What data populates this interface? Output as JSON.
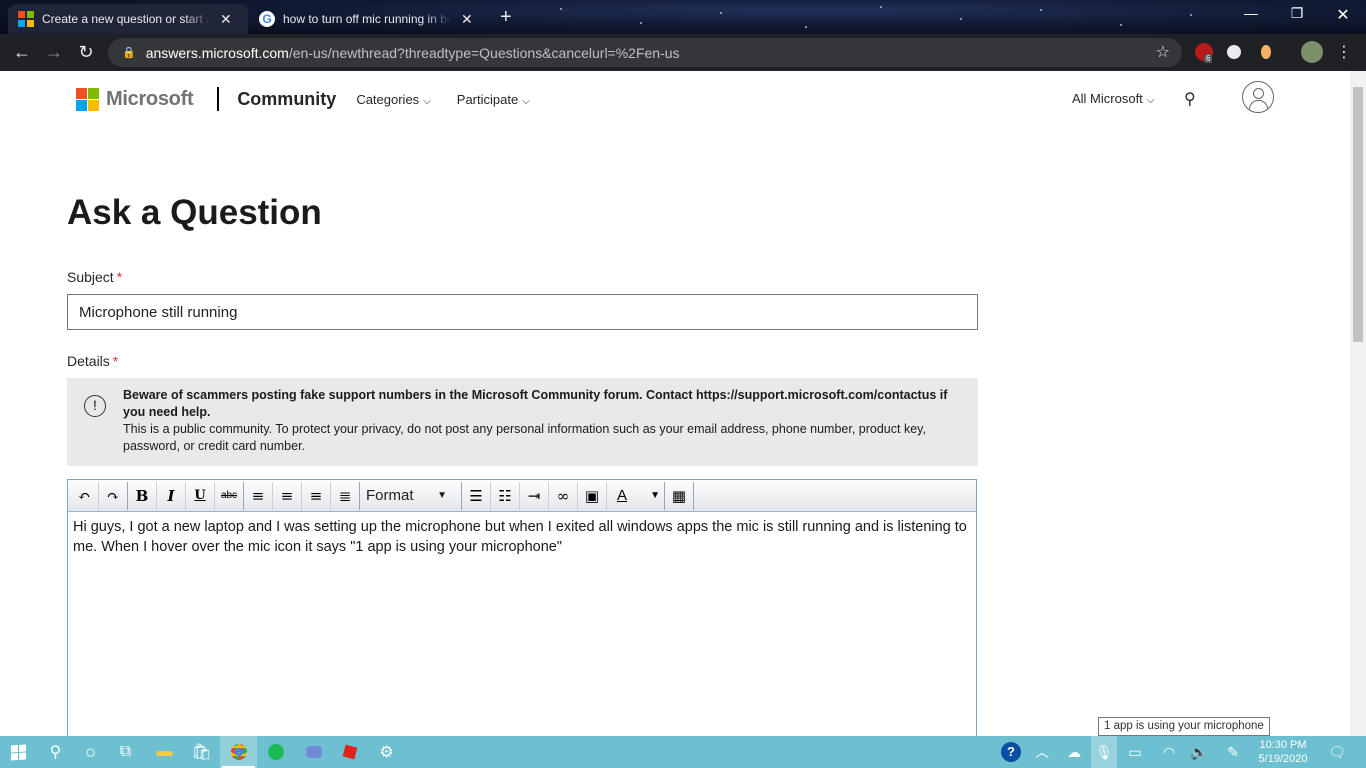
{
  "browser": {
    "tabs": [
      {
        "title": "Create a new question or start a d",
        "active": true
      },
      {
        "title": "how to turn off mic running in be",
        "active": false
      }
    ],
    "url_host": "answers.microsoft.com",
    "url_path": "/en-us/newthread?threadtype=Questions&cancelurl=%2Fen-us",
    "extension_badge": "6"
  },
  "site": {
    "brand": "Microsoft",
    "community": "Community",
    "nav": [
      "Categories",
      "Participate"
    ],
    "all_microsoft": "All Microsoft"
  },
  "form": {
    "title": "Ask a Question",
    "subject_label": "Subject",
    "subject_value": "Microphone still running",
    "details_label": "Details",
    "required_mark": "*",
    "notice_bold": "Beware of scammers posting fake support numbers in the Microsoft Community forum. Contact https://support.microsoft.com/contactus if you need help.",
    "notice_text": "This is a public community. To protect your privacy, do not post any personal information such as your email address, phone number, product key, password, or credit card number.",
    "format_label": "Format",
    "body_text": "Hi guys, I got a new laptop and I was setting up the microphone but when I exited all windows apps the mic is still running and is listening to me. When I hover over the mic icon it says \"1 app is using your microphone\""
  },
  "tooltip": "1 app is using your microphone",
  "taskbar": {
    "time": "10:30 PM",
    "date": "5/19/2020"
  },
  "colors": {
    "ms_red": "#f25022",
    "ms_green": "#7fba00",
    "ms_blue": "#00a4ef",
    "ms_yellow": "#ffb900",
    "taskbar": "#6cc0cf",
    "required": "#d13438"
  }
}
